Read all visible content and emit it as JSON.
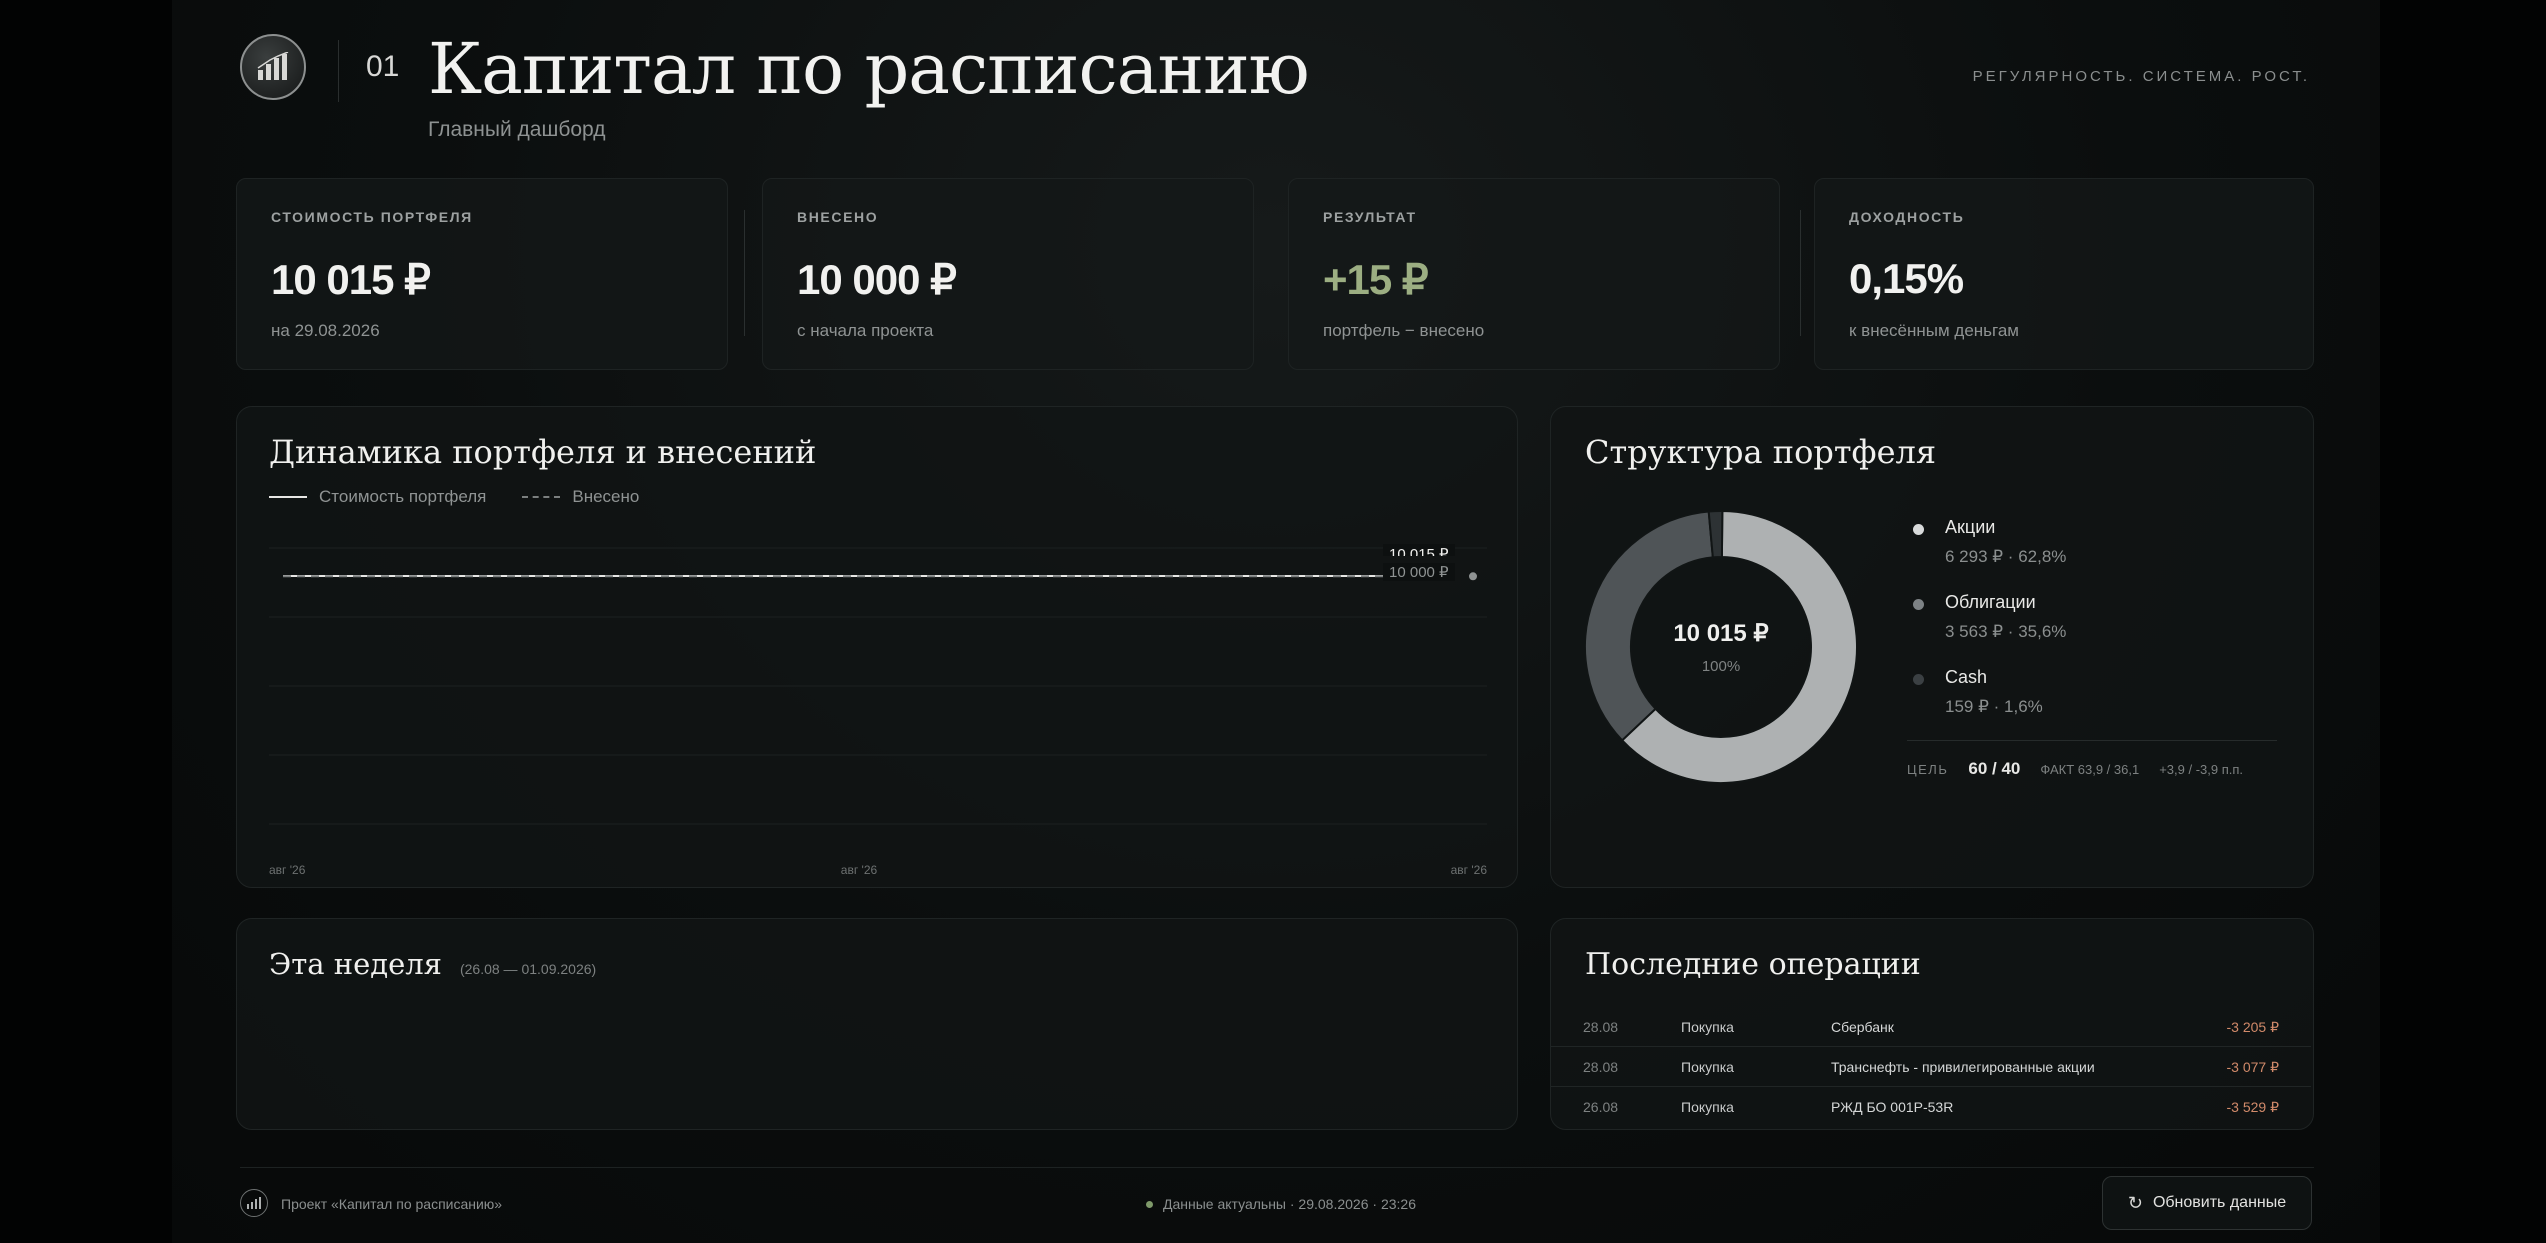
{
  "header": {
    "number": "01",
    "title": "Капитал по расписанию",
    "subtitle": "Главный дашборд",
    "motto": "РЕГУЛЯРНОСТЬ. СИСТЕМА. РОСТ."
  },
  "kpis": [
    {
      "label": "СТОИМОСТЬ ПОРТФЕЛЯ",
      "value": "10 015 ₽",
      "sub": "на 29.08.2026"
    },
    {
      "label": "ВНЕСЕНО",
      "value": "10 000 ₽",
      "sub": "с начала проекта"
    },
    {
      "label": "РЕЗУЛЬТАТ",
      "value": "+15 ₽",
      "sub": "портфель − внесено"
    },
    {
      "label": "ДОХОДНОСТЬ",
      "value": "0,15%",
      "sub": "к внесённым деньгам"
    }
  ],
  "dynamics": {
    "title": "Динамика портфеля и внесений",
    "legend_value": "Стоимость портфеля",
    "legend_invested": "Внесено",
    "label_value": "10 015 ₽",
    "label_invested": "10 000 ₽",
    "x_ticks": [
      "авг '26",
      "авг '26",
      "авг '26"
    ]
  },
  "chart_data": {
    "type": "line",
    "x": [
      "авг '26",
      "авг '26",
      "авг '26"
    ],
    "series": [
      {
        "name": "Стоимость портфеля",
        "values": [
          10015,
          10015,
          10015
        ]
      },
      {
        "name": "Внесено",
        "values": [
          10000,
          10000,
          10000
        ]
      }
    ],
    "grid": true,
    "legend": "top-left"
  },
  "structure": {
    "title": "Структура портфеля",
    "center_value": "10 015 ₽",
    "center_pct": "100%",
    "items": [
      {
        "name": "Акции",
        "detail": "6 293 ₽ · 62,8%",
        "share": 62.8,
        "color": "#aeb1b2"
      },
      {
        "name": "Облигации",
        "detail": "3 563 ₽ · 35,6%",
        "share": 35.6,
        "color": "#4f5457"
      },
      {
        "name": "Cash",
        "detail": "159 ₽ · 1,6%",
        "share": 1.6,
        "color": "#2d3234"
      }
    ],
    "target_label": "ЦЕЛЬ",
    "target_value": "60 / 40",
    "fact": "ФАКТ 63,9 / 36,1",
    "diff": "+3,9 / -3,9 п.п."
  },
  "week": {
    "title": "Эта неделя",
    "range": "(26.08 — 01.09.2026)"
  },
  "operations": {
    "title": "Последние операции",
    "rows": [
      {
        "date": "28.08",
        "type": "Покупка",
        "name": "Сбербанк",
        "amount": "-3 205 ₽"
      },
      {
        "date": "28.08",
        "type": "Покупка",
        "name": "Транснефть - привилегированные акции",
        "amount": "-3 077 ₽"
      },
      {
        "date": "26.08",
        "type": "Покупка",
        "name": "РЖД БО 001P-53R",
        "amount": "-3 529 ₽"
      }
    ]
  },
  "footer": {
    "project": "Проект «Капитал по расписанию»",
    "status": "Данные актуальны · 29.08.2026 · 23:26",
    "refresh_label": "Обновить данные"
  },
  "colors": {
    "accent_green": "#9cae82",
    "negative": "#d18a6a",
    "status_dot": "#7f9a6a"
  }
}
